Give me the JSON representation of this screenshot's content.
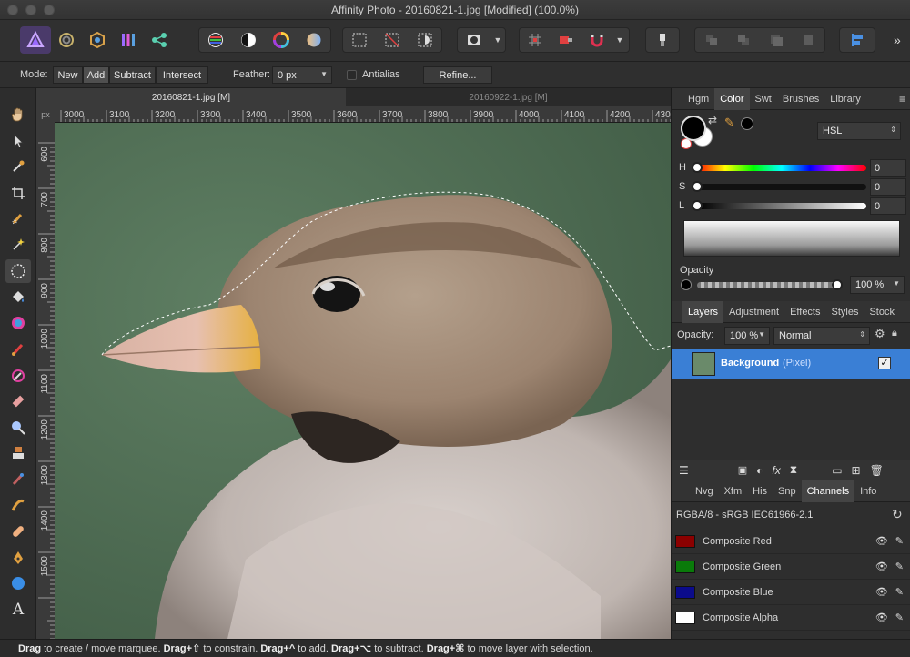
{
  "window": {
    "title": "Affinity Photo - 20160821-1.jpg [Modified] (100.0%)"
  },
  "context_bar": {
    "mode_label": "Mode:",
    "modes": [
      "New",
      "Add",
      "Subtract",
      "Intersect"
    ],
    "active_mode": "Add",
    "feather_label": "Feather:",
    "feather_value": "0 px",
    "antialias_label": "Antialias",
    "refine_label": "Refine..."
  },
  "document_tabs": [
    {
      "label": "20160821-1.jpg [M]",
      "active": true
    },
    {
      "label": "20160922-1.jpg [M]",
      "active": false
    }
  ],
  "ruler": {
    "unit": "px",
    "h_ticks": [
      "3000",
      "3100",
      "3200",
      "3300",
      "3400",
      "3500",
      "3600",
      "3700",
      "3800",
      "3900",
      "4000",
      "4100",
      "4200",
      "430"
    ],
    "v_ticks": [
      "600",
      "700",
      "800",
      "900",
      "1000",
      "1100",
      "1200",
      "1300",
      "1400",
      "1500"
    ]
  },
  "color_panel": {
    "tabs": [
      "Hgm",
      "Color",
      "Swt",
      "Brushes",
      "Library"
    ],
    "active_tab": "Color",
    "model": "HSL",
    "sliders": [
      {
        "label": "H",
        "value": "0"
      },
      {
        "label": "S",
        "value": "0"
      },
      {
        "label": "L",
        "value": "0"
      }
    ],
    "opacity_label": "Opacity",
    "opacity_value": "100 %"
  },
  "layers_panel": {
    "tabs": [
      "Layers",
      "Adjustment",
      "Effects",
      "Styles",
      "Stock"
    ],
    "active_tab": "Layers",
    "opacity_label": "Opacity:",
    "opacity_value": "100 %",
    "blend_mode": "Normal",
    "layers": [
      {
        "name": "Background",
        "type": "(Pixel)",
        "visible": true
      }
    ]
  },
  "channels_panel": {
    "tabs": [
      "Nvg",
      "Xfm",
      "His",
      "Snp",
      "Channels",
      "Info"
    ],
    "active_tab": "Channels",
    "profile": "RGBA/8 - sRGB IEC61966-2.1",
    "channels": [
      {
        "name": "Composite Red",
        "color": "#8b0000"
      },
      {
        "name": "Composite Green",
        "color": "#0a7a0a"
      },
      {
        "name": "Composite Blue",
        "color": "#0b0b8b"
      },
      {
        "name": "Composite Alpha",
        "color": "#ffffff"
      }
    ]
  },
  "status_bar": {
    "segments": [
      {
        "text": "Drag",
        "bold": true
      },
      {
        "text": " to create / move marquee. ",
        "bold": false
      },
      {
        "text": "Drag+⇧",
        "bold": true
      },
      {
        "text": " to constrain. ",
        "bold": false
      },
      {
        "text": "Drag+^",
        "bold": true
      },
      {
        "text": " to add. ",
        "bold": false
      },
      {
        "text": "Drag+⌥",
        "bold": true
      },
      {
        "text": " to subtract. ",
        "bold": false
      },
      {
        "text": "Drag+⌘",
        "bold": true
      },
      {
        "text": " to move layer with selection.",
        "bold": false
      }
    ]
  },
  "colors": {
    "accent": "#3a7fd5",
    "canvas_bg": "#4e6b52",
    "primary_color": "#000000",
    "secondary_color": "#ffffff"
  }
}
